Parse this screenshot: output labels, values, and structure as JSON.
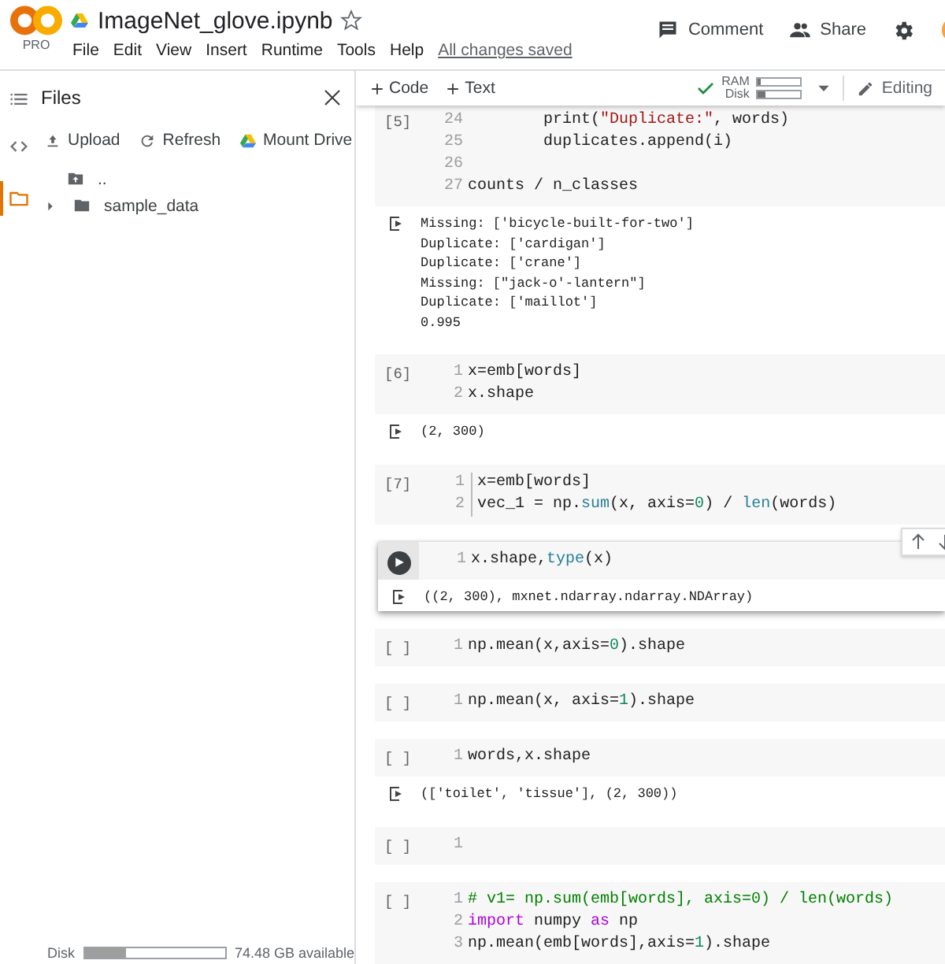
{
  "header": {
    "logo_badge": "PRO",
    "title": "ImageNet_glove.ipynb",
    "starred": false,
    "menu": [
      "File",
      "Edit",
      "View",
      "Insert",
      "Runtime",
      "Tools",
      "Help"
    ],
    "save_status": "All changes saved",
    "actions": [
      {
        "label": "Comment"
      },
      {
        "label": "Share"
      }
    ]
  },
  "rail": [
    {
      "selected": false
    },
    {
      "selected": false
    },
    {
      "selected": true
    }
  ],
  "files": {
    "title": "Files",
    "toolbar": [
      {
        "label": "Upload"
      },
      {
        "label": "Refresh"
      },
      {
        "label": "Mount Drive"
      }
    ],
    "tree": [
      {
        "name": "..",
        "kind": "parent"
      },
      {
        "name": "sample_data",
        "kind": "folder",
        "expanded": false
      }
    ],
    "disk": {
      "label": "Disk",
      "level": 0.3,
      "reading": "74.48 GB available"
    }
  },
  "toolbar": {
    "add": [
      "Code",
      "Text"
    ],
    "connected": true,
    "meters": [
      {
        "label": "RAM",
        "level": 0.08
      },
      {
        "label": "Disk",
        "level": 0.2
      }
    ],
    "mode": "Editing"
  },
  "cells": [
    {
      "exec": "[5]",
      "selected": false,
      "editor_open": false,
      "lines": [
        {
          "num": "24",
          "tokens": [
            {
              "text": "        print(",
              "kind": "plain"
            },
            {
              "text": "\"Duplicate:\"",
              "kind": "string"
            },
            {
              "text": ", words)",
              "kind": "plain"
            }
          ]
        },
        {
          "num": "25",
          "tokens": [
            {
              "text": "        duplicates.append(i)",
              "kind": "plain"
            }
          ]
        },
        {
          "num": "26"
        },
        {
          "num": "27",
          "tokens": [
            {
              "text": "counts / n_classes",
              "kind": "plain"
            }
          ]
        }
      ],
      "output": [
        "Missing: ['bicycle-built-for-two']",
        "Duplicate: ['cardigan']",
        "Duplicate: ['crane']",
        "Missing: [\"jack-o'-lantern\"]",
        "Duplicate: ['maillot']",
        "0.995"
      ]
    },
    {
      "exec": "[6]",
      "selected": false,
      "editor_open": false,
      "lines": [
        {
          "num": "1",
          "tokens": [
            {
              "text": "x=emb[words]",
              "kind": "plain"
            }
          ]
        },
        {
          "num": "2",
          "tokens": [
            {
              "text": "x.shape",
              "kind": "plain"
            }
          ]
        }
      ],
      "output": [
        "(2, 300)"
      ]
    },
    {
      "exec": "[7]",
      "selected": false,
      "editor_open": true,
      "lines": [
        {
          "num": "1",
          "tokens": [
            {
              "text": "x=emb[words]",
              "kind": "plain"
            }
          ]
        },
        {
          "num": "2",
          "tokens": [
            {
              "text": "vec_1 = np.",
              "kind": "plain"
            },
            {
              "text": "sum",
              "kind": "builtin"
            },
            {
              "text": "(x, axis=",
              "kind": "plain"
            },
            {
              "text": "0",
              "kind": "number"
            },
            {
              "text": ") / ",
              "kind": "plain"
            },
            {
              "text": "len",
              "kind": "builtin"
            },
            {
              "text": "(words)",
              "kind": "plain"
            }
          ]
        }
      ]
    },
    {
      "selected": true,
      "editor_open": false,
      "lines": [
        {
          "num": "1",
          "tokens": [
            {
              "text": "x.shape,",
              "kind": "plain"
            },
            {
              "text": "type",
              "kind": "builtin"
            },
            {
              "text": "(x)",
              "kind": "plain"
            }
          ]
        }
      ],
      "output": [
        "((2, 300), mxnet.ndarray.ndarray.NDArray)"
      ]
    },
    {
      "exec": "[ ]",
      "selected": false,
      "editor_open": false,
      "lines": [
        {
          "num": "1",
          "tokens": [
            {
              "text": "np.mean(x,axis=",
              "kind": "plain"
            },
            {
              "text": "0",
              "kind": "number"
            },
            {
              "text": ").shape",
              "kind": "plain"
            }
          ]
        }
      ]
    },
    {
      "exec": "[ ]",
      "selected": false,
      "editor_open": false,
      "lines": [
        {
          "num": "1",
          "tokens": [
            {
              "text": "np.mean(x, axis=",
              "kind": "plain"
            },
            {
              "text": "1",
              "kind": "number"
            },
            {
              "text": ").shape",
              "kind": "plain"
            }
          ]
        }
      ]
    },
    {
      "exec": "[ ]",
      "selected": false,
      "editor_open": false,
      "lines": [
        {
          "num": "1",
          "tokens": [
            {
              "text": "words,x.shape",
              "kind": "plain"
            }
          ]
        }
      ],
      "output": [
        "(['toilet', 'tissue'], (2, 300))"
      ]
    },
    {
      "exec": "[ ]",
      "selected": false,
      "editor_open": false,
      "lines": [
        {
          "num": "1"
        }
      ]
    },
    {
      "exec": "[ ]",
      "selected": false,
      "editor_open": false,
      "lines": [
        {
          "num": "1",
          "tokens": [
            {
              "text": "# v1= np.sum(emb[words], axis=0) / len(words)",
              "kind": "comment"
            }
          ]
        },
        {
          "num": "2",
          "tokens": [
            {
              "text": "import",
              "kind": "keyword"
            },
            {
              "text": " numpy ",
              "kind": "plain"
            },
            {
              "text": "as",
              "kind": "keyword"
            },
            {
              "text": " np",
              "kind": "plain"
            }
          ]
        },
        {
          "num": "3",
          "tokens": [
            {
              "text": "np.mean(emb[words],axis=",
              "kind": "plain"
            },
            {
              "text": "1",
              "kind": "number"
            },
            {
              "text": ").shape",
              "kind": "plain"
            }
          ]
        }
      ]
    }
  ]
}
